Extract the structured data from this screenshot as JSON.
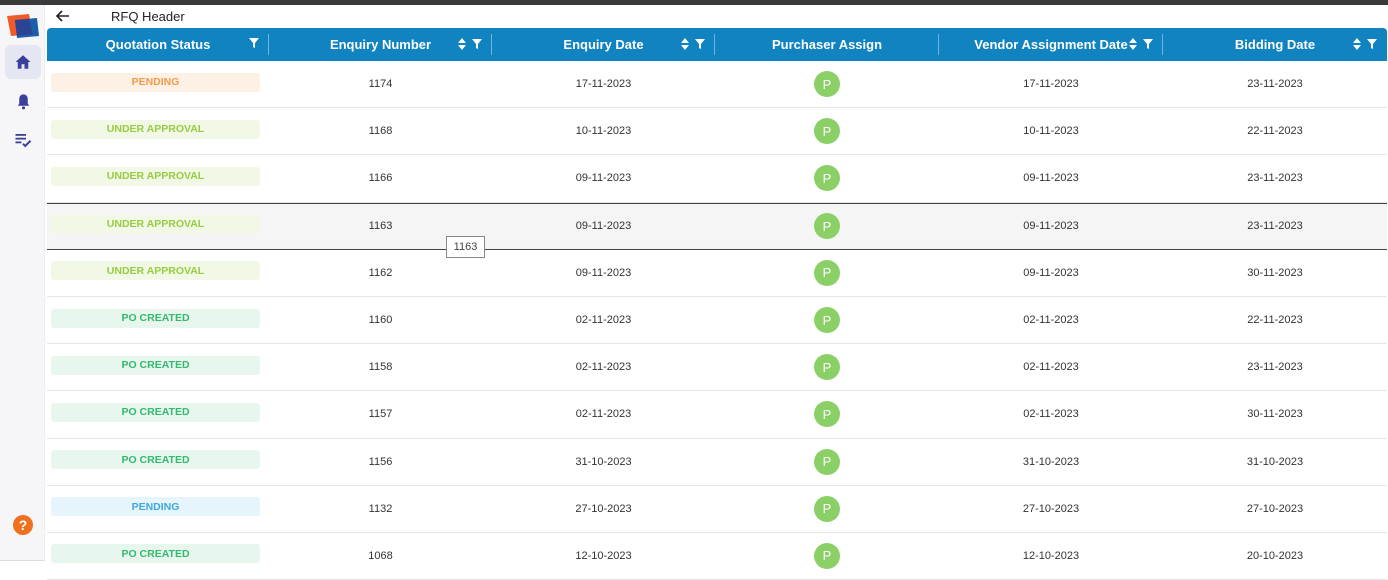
{
  "app": {
    "title": "RFQ Header",
    "brand_colors": {
      "primary": "#1083c0",
      "accent": "#f0701f"
    }
  },
  "sidebar": {
    "items": [
      {
        "name": "home",
        "icon": "home-icon",
        "active": true
      },
      {
        "name": "notifications",
        "icon": "bell-icon",
        "active": false
      },
      {
        "name": "tasks",
        "icon": "checklist-icon",
        "active": false
      }
    ],
    "help_icon": "?"
  },
  "table": {
    "columns": [
      {
        "label": "Quotation Status",
        "sort": false,
        "filter": true
      },
      {
        "label": "Enquiry Number",
        "sort": true,
        "filter": true
      },
      {
        "label": "Enquiry Date",
        "sort": true,
        "filter": true
      },
      {
        "label": "Purchaser Assign",
        "sort": false,
        "filter": false
      },
      {
        "label": "Vendor Assignment Date",
        "sort": true,
        "filter": true
      },
      {
        "label": "Bidding Date",
        "sort": true,
        "filter": true
      }
    ],
    "rows": [
      {
        "status": "PENDING",
        "status_style": "pending-orange",
        "number": "1174",
        "enquiry_date": "17-11-2023",
        "purchaser": "P",
        "vendor_date": "17-11-2023",
        "bidding_date": "23-11-2023"
      },
      {
        "status": "UNDER APPROVAL",
        "status_style": "approval",
        "number": "1168",
        "enquiry_date": "10-11-2023",
        "purchaser": "P",
        "vendor_date": "10-11-2023",
        "bidding_date": "22-11-2023"
      },
      {
        "status": "UNDER APPROVAL",
        "status_style": "approval",
        "number": "1166",
        "enquiry_date": "09-11-2023",
        "purchaser": "P",
        "vendor_date": "09-11-2023",
        "bidding_date": "23-11-2023"
      },
      {
        "status": "UNDER APPROVAL",
        "status_style": "approval",
        "number": "1163",
        "enquiry_date": "09-11-2023",
        "purchaser": "P",
        "vendor_date": "09-11-2023",
        "bidding_date": "23-11-2023",
        "hover": true
      },
      {
        "status": "UNDER APPROVAL",
        "status_style": "approval",
        "number": "1162",
        "enquiry_date": "09-11-2023",
        "purchaser": "P",
        "vendor_date": "09-11-2023",
        "bidding_date": "30-11-2023"
      },
      {
        "status": "PO CREATED",
        "status_style": "po",
        "number": "1160",
        "enquiry_date": "02-11-2023",
        "purchaser": "P",
        "vendor_date": "02-11-2023",
        "bidding_date": "22-11-2023"
      },
      {
        "status": "PO CREATED",
        "status_style": "po",
        "number": "1158",
        "enquiry_date": "02-11-2023",
        "purchaser": "P",
        "vendor_date": "02-11-2023",
        "bidding_date": "23-11-2023"
      },
      {
        "status": "PO CREATED",
        "status_style": "po",
        "number": "1157",
        "enquiry_date": "02-11-2023",
        "purchaser": "P",
        "vendor_date": "02-11-2023",
        "bidding_date": "30-11-2023"
      },
      {
        "status": "PO CREATED",
        "status_style": "po",
        "number": "1156",
        "enquiry_date": "31-10-2023",
        "purchaser": "P",
        "vendor_date": "31-10-2023",
        "bidding_date": "31-10-2023"
      },
      {
        "status": "PENDING",
        "status_style": "pending-blue",
        "number": "1132",
        "enquiry_date": "27-10-2023",
        "purchaser": "P",
        "vendor_date": "27-10-2023",
        "bidding_date": "27-10-2023"
      },
      {
        "status": "PO CREATED",
        "status_style": "po",
        "number": "1068",
        "enquiry_date": "12-10-2023",
        "purchaser": "P",
        "vendor_date": "12-10-2023",
        "bidding_date": "20-10-2023"
      }
    ],
    "tooltip": "1163"
  }
}
